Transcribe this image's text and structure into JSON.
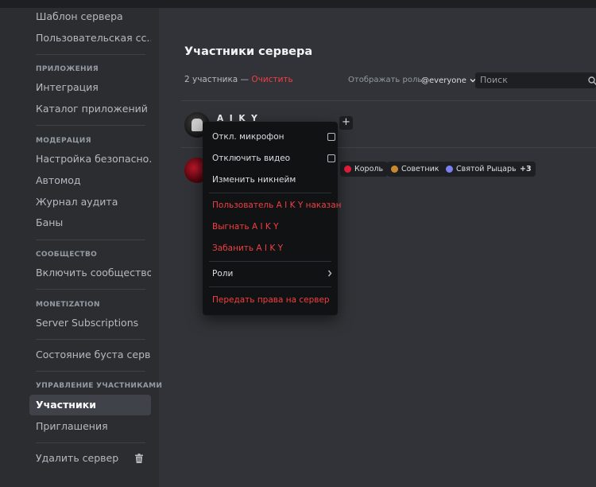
{
  "sidebar": {
    "items_top": [
      "Шаблон сервера",
      "Пользовательская сс..."
    ],
    "apps_header": "ПРИЛОЖЕНИЯ",
    "apps_items": [
      "Интеграция",
      "Каталог приложений (..."
    ],
    "mod_header": "МОДЕРАЦИЯ",
    "mod_items": [
      "Настройка безопасно...",
      "Автомод",
      "Журнал аудита",
      "Баны"
    ],
    "community_header": "СООБЩЕСТВО",
    "community_items": [
      "Включить сообщество"
    ],
    "monetization_header": "MONETIZATION",
    "monetization_items": [
      "Server Subscriptions"
    ],
    "boost_item": "Состояние буста сервера",
    "members_header": "УПРАВЛЕНИЕ УЧАСТНИКАМИ",
    "members_items": [
      "Участники",
      "Приглашения"
    ],
    "delete_item": "Удалить сервер"
  },
  "main": {
    "title": "Участники сервера",
    "count_text": "2 участника —",
    "clear_label": "Очистить",
    "role_filter_label": "Отображать роль:",
    "role_filter_value": "@everyone",
    "search_placeholder": "Поиск",
    "member1_name": "A I K Y",
    "add_role_label": "+",
    "roles": [
      {
        "name": "Король",
        "color": "#e91e3c"
      },
      {
        "name": "Советник",
        "color": "#c98a2e"
      },
      {
        "name": "Святой Рыцарь",
        "color": "#7b7ff0"
      }
    ],
    "roles_more": "+3"
  },
  "context_menu": {
    "mute_mic": "Откл. микрофон",
    "disable_video": "Отключить видео",
    "change_nickname": "Изменить никнейм",
    "timeout": "Пользователь A I K Y наказан",
    "kick": "Выгнать A I K Y",
    "ban": "Забанить A I K Y",
    "roles": "Роли",
    "transfer": "Передать права на сервер"
  },
  "colors": {
    "danger": "#f23f42",
    "background": "#313338",
    "sidebar": "#2b2d31",
    "menu": "#111214"
  }
}
